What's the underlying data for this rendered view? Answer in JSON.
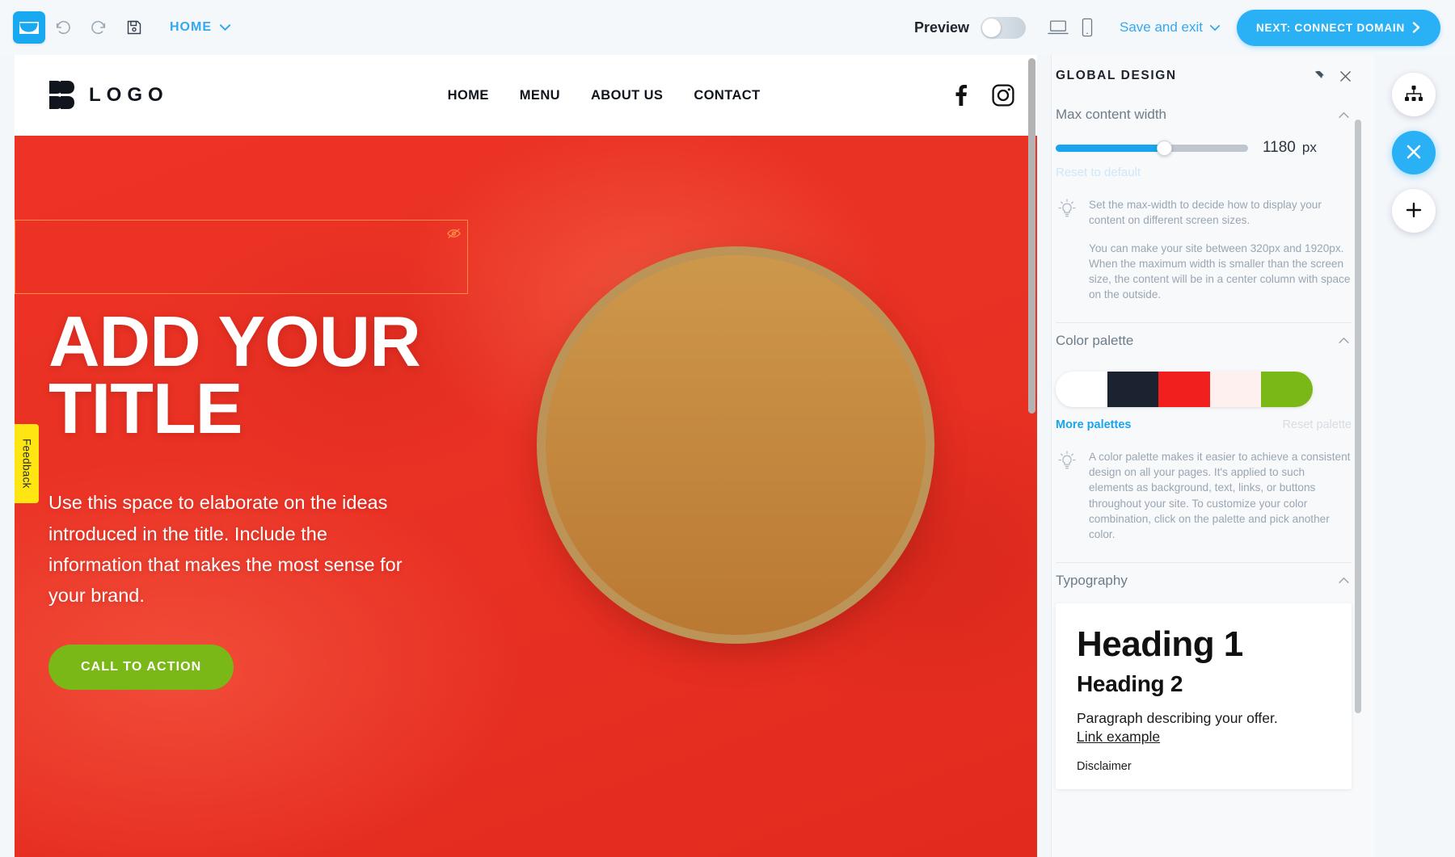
{
  "toolbar": {
    "brand_icon": "mail-envelope-icon",
    "undo_icon": "undo-arrow-icon",
    "redo_icon": "redo-arrow-icon",
    "save_icon": "floppy-disk-save-icon",
    "page_selector_label": "HOME",
    "page_selector_chevron": "chevron-down-icon",
    "preview_label": "Preview",
    "preview_toggle_state": "off",
    "desktop_icon": "laptop-icon",
    "mobile_icon": "mobile-phone-icon",
    "save_and_exit_label": "Save and exit",
    "save_and_exit_chevron": "chevron-down-icon",
    "next_button_label": "NEXT: CONNECT DOMAIN",
    "next_button_arrow": "chevron-right-icon",
    "accent_color": "#29b0f5",
    "link_color": "#34a8ef"
  },
  "canvas": {
    "site_nav": {
      "logo_text": "LOGO",
      "logo_mark": "double-chevron-brand-icon",
      "menu": [
        {
          "label": "HOME"
        },
        {
          "label": "MENU"
        },
        {
          "label": "ABOUT US"
        },
        {
          "label": "CONTACT"
        }
      ],
      "social": [
        {
          "name": "facebook-icon"
        },
        {
          "name": "instagram-icon"
        }
      ]
    },
    "hero": {
      "selection_hidden_icon": "eye-slash-hidden-icon",
      "title": "ADD YOUR TITLE",
      "subtitle": "Use this space to elaborate on the ideas introduced in the title. Include the information that makes the most sense for your brand.",
      "cta_label": "CALL TO ACTION",
      "cta_color": "#79b816",
      "background_color": "#ec3325",
      "image_alt": "pizza-photo"
    },
    "feedback_tab_label": "Feedback",
    "feedback_tab_color": "#ffe511"
  },
  "panel": {
    "title": "GLOBAL DESIGN",
    "pin_icon": "pin-icon",
    "close_icon": "close-x-icon",
    "sections": {
      "max_content_width": {
        "title": "Max content width",
        "collapse_icon": "chevron-up-icon",
        "value": "1180",
        "unit": "px",
        "reset_label": "Reset to default",
        "hint_icon": "lightbulb-idea-icon",
        "hint_paragraph_1": "Set the max-width to decide how to display your content on different screen sizes.",
        "hint_paragraph_2": "You can make your site between 320px and 1920px. When the maximum width is smaller than the screen size, the content will be in a center column with space on the outside."
      },
      "color_palette": {
        "title": "Color palette",
        "collapse_icon": "chevron-up-icon",
        "swatches": [
          "#ffffff",
          "#1b2330",
          "#f21f1f",
          "#fdf0ef",
          "#79b816"
        ],
        "more_palettes_label": "More palettes",
        "reset_palette_label": "Reset palette",
        "hint_icon": "lightbulb-idea-icon",
        "hint_paragraph": "A color palette makes it easier to achieve a consistent design on all your pages. It's applied to such elements as background, text, links, or buttons throughout your site. To customize your color combination, click on the palette and pick another color."
      },
      "typography": {
        "title": "Typography",
        "collapse_icon": "chevron-up-icon",
        "preview": {
          "heading1": "Heading 1",
          "heading2": "Heading 2",
          "paragraph": "Paragraph describing your offer.",
          "link": "Link example",
          "disclaimer": "Disclaimer"
        }
      }
    }
  },
  "rail": {
    "sitemap_button_icon": "sitemap-hierarchy-icon",
    "close_button_icon": "close-x-icon",
    "add_button_icon": "plus-add-icon"
  }
}
